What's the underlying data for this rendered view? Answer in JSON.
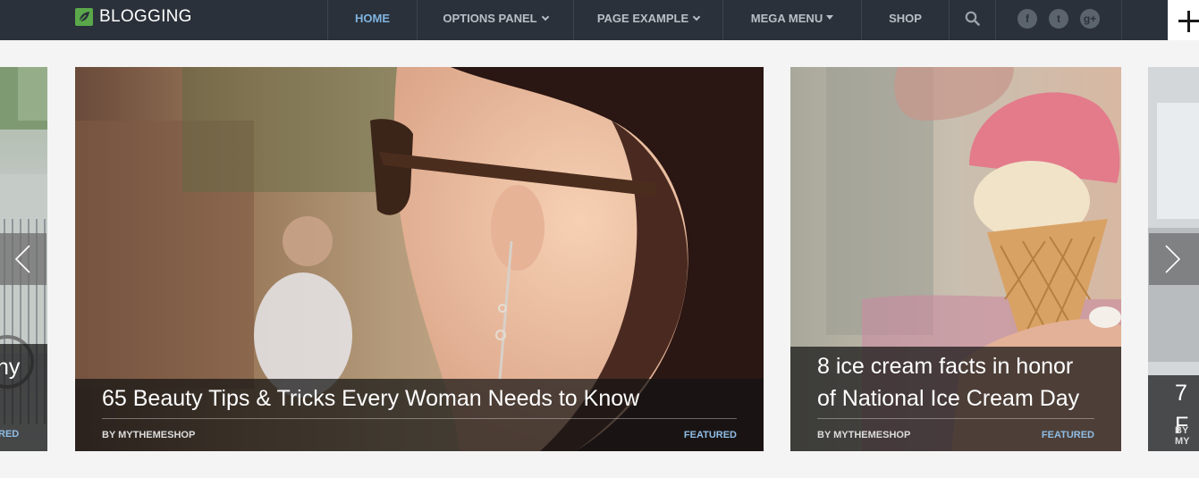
{
  "brand": {
    "name": "BLOGGING"
  },
  "nav": {
    "items": [
      {
        "label": "HOME",
        "active": true
      },
      {
        "label": "OPTIONS PANEL",
        "dropdown": true
      },
      {
        "label": "PAGE EXAMPLE",
        "dropdown": true
      },
      {
        "label": "MEGA MENU",
        "dropdown": true
      },
      {
        "label": "SHOP"
      }
    ],
    "search_icon": "search-icon",
    "social": [
      {
        "icon": "facebook-icon",
        "glyph": "f"
      },
      {
        "icon": "twitter-icon",
        "glyph": "t"
      },
      {
        "icon": "googleplus-icon",
        "glyph": "g+"
      }
    ]
  },
  "slider": {
    "left_partial": {
      "title_fragment": "hy",
      "cat_fragment": "RED"
    },
    "main": {
      "title": "65 Beauty Tips & Tricks Every Woman Needs to Know",
      "author": "BY MYTHEMESHOP",
      "category": "FEATURED"
    },
    "second": {
      "title": "8 ice cream facts in honor of National Ice Cream Day",
      "author": "BY MYTHEMESHOP",
      "category": "FEATURED"
    },
    "right_partial": {
      "title_fragment": "7 F",
      "author_fragment": "BY MY"
    }
  },
  "colors": {
    "nav_bg": "#2a313a",
    "accent": "#7fb3df",
    "logo_green": "#5aa84a",
    "caption_bg": "#141414"
  }
}
